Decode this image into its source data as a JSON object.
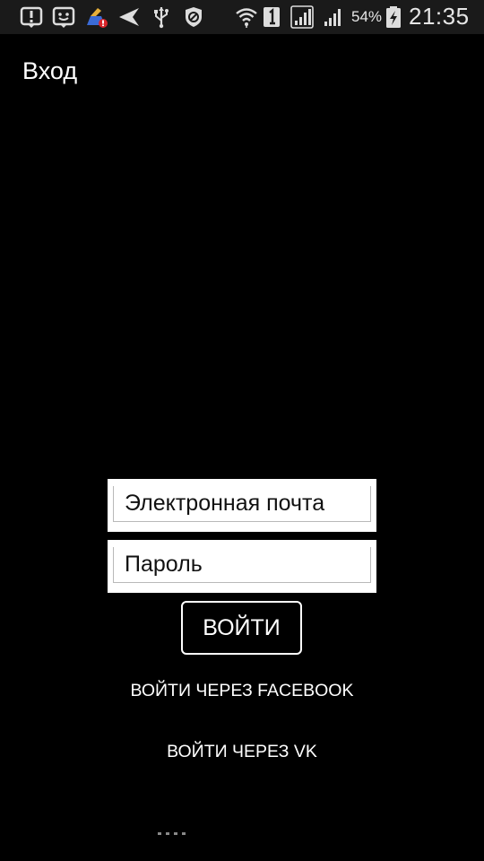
{
  "status_bar": {
    "icons": [
      "alert-icon",
      "smiley-notification-icon",
      "cleaner-app-icon",
      "send-icon",
      "usb-icon",
      "blocked-icon",
      "wifi-icon",
      "sim-1-icon",
      "signal-icon",
      "signal-secondary-icon",
      "battery-charging-icon"
    ],
    "battery_percent": "54%",
    "time": "21:35"
  },
  "header": {
    "title": "Вход"
  },
  "login_form": {
    "email_placeholder": "Электронная почта",
    "email_value": "",
    "password_placeholder": "Пароль",
    "password_value": "",
    "login_label": "ВОЙТИ",
    "facebook_label": "ВОЙТИ ЧЕРЕЗ FACEBOOK",
    "vk_label": "ВОЙТИ ЧЕРЕЗ VK"
  },
  "colors": {
    "background": "#000000",
    "status_bar": "#1a1a1a",
    "field_background": "#ffffff",
    "text": "#ffffff"
  }
}
